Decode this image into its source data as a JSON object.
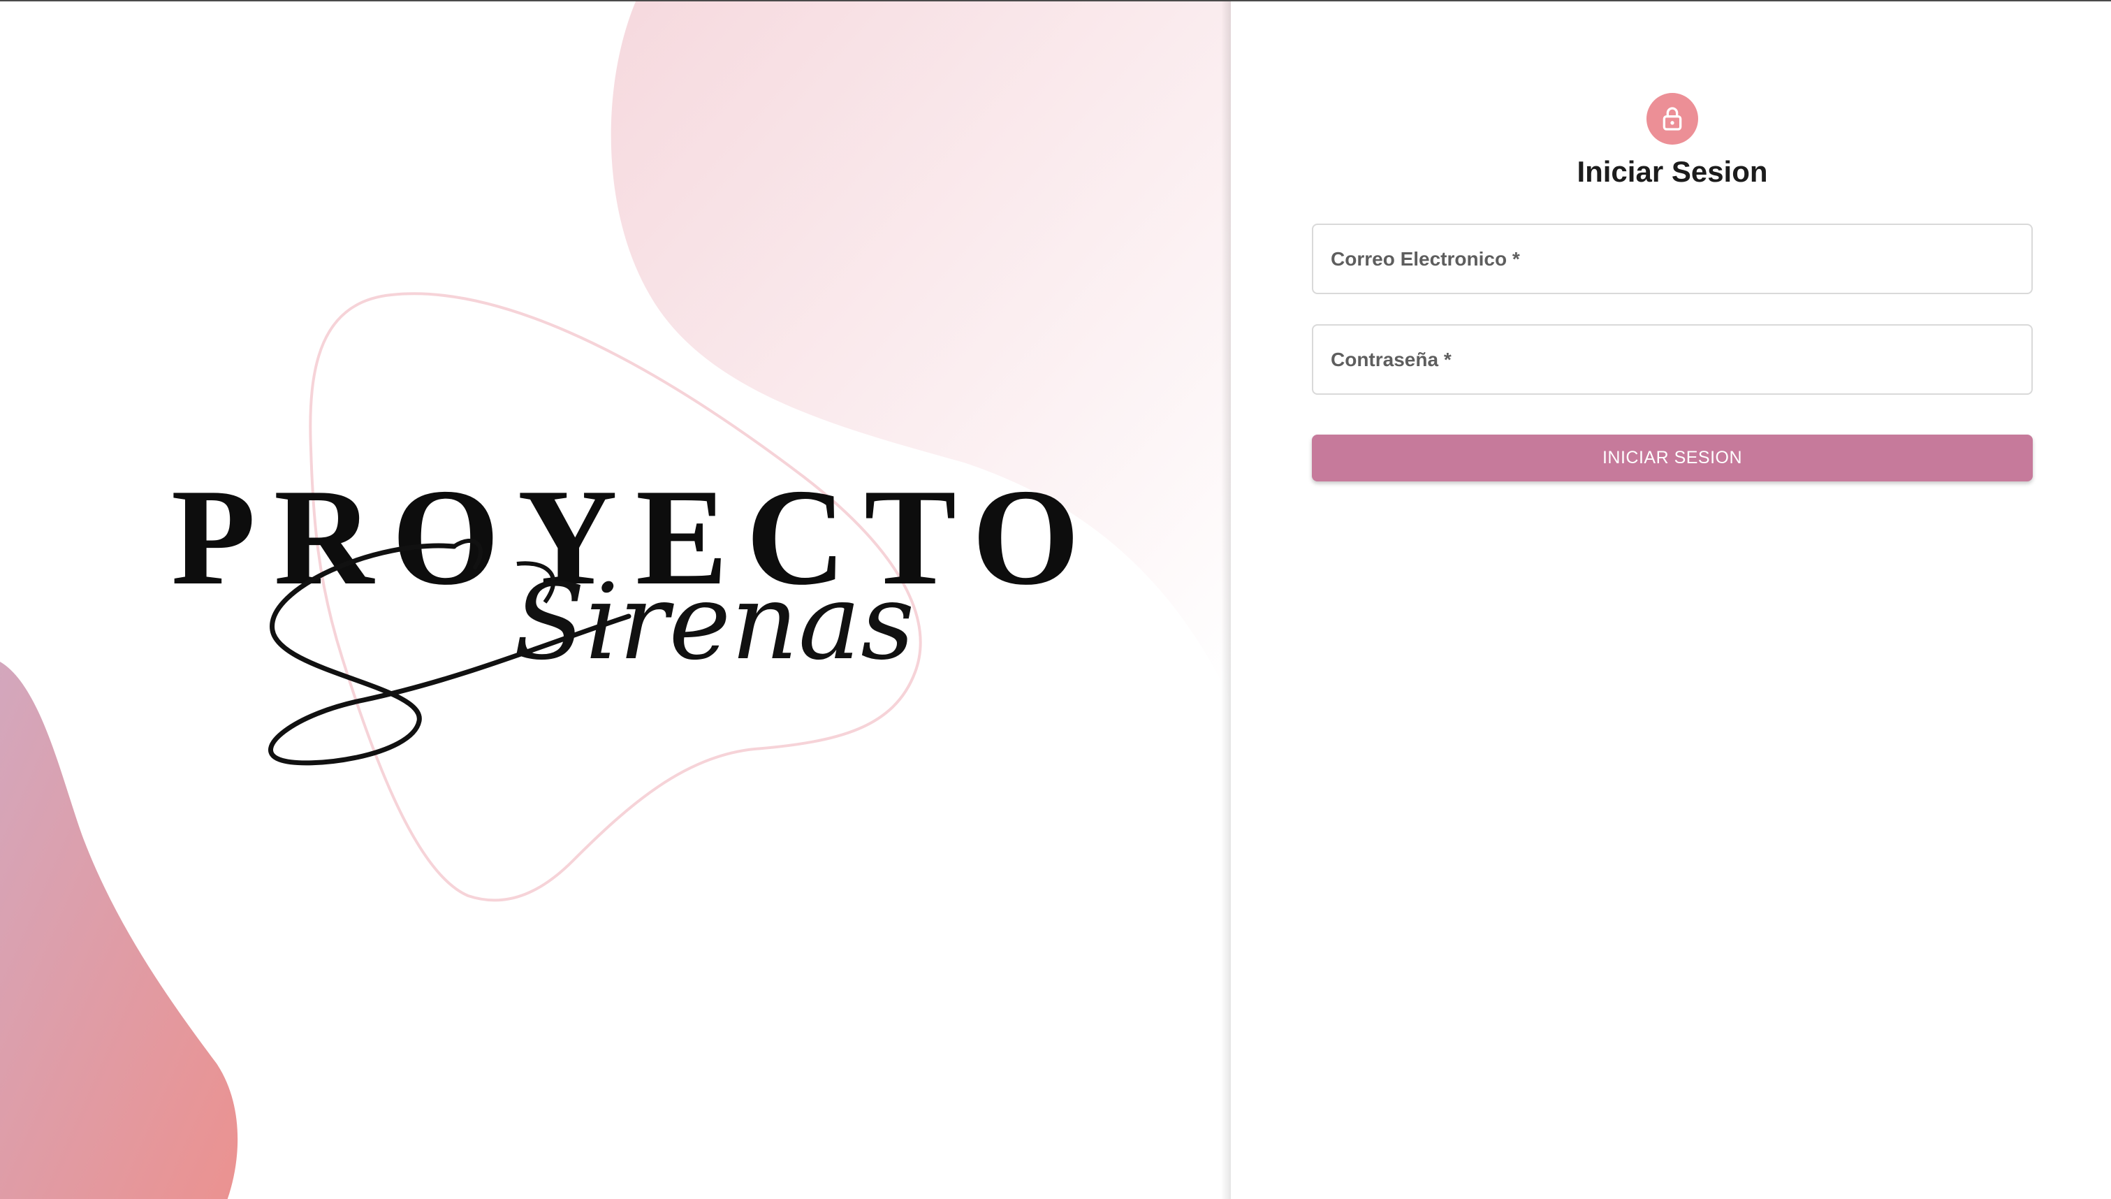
{
  "hero": {
    "logo_title": "PROYECTO",
    "logo_script": "Sirenas"
  },
  "login": {
    "icon": "lock-icon",
    "title": "Iniciar Sesion",
    "email_label": "Correo Electronico *",
    "password_label": "Contraseña *",
    "submit_label": "INICIAR SESION"
  },
  "colors": {
    "accent": "#c67a9b",
    "avatar": "#ec8f96",
    "blob_pink": "#f7dde1",
    "blob_coral": "#e8959a",
    "blob_mauve": "#d3a7bd"
  }
}
